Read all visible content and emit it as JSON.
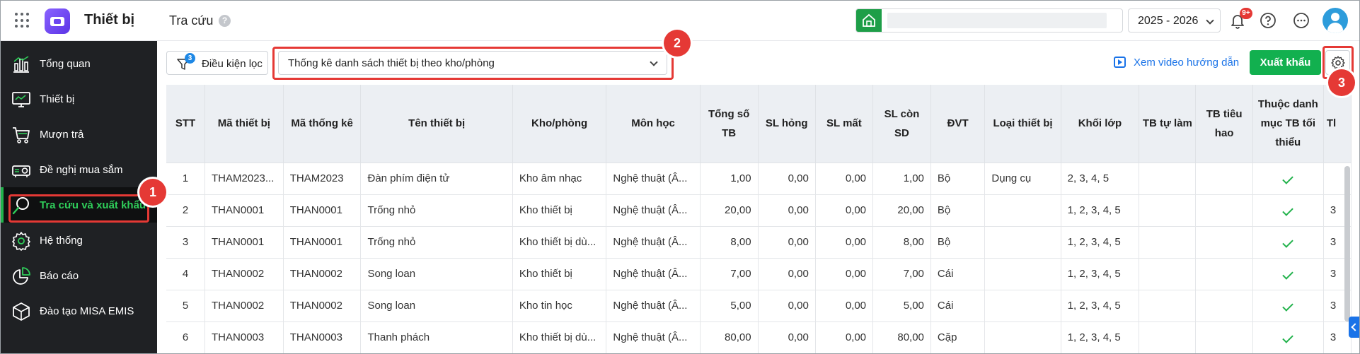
{
  "header": {
    "app_title": "Thiết bị",
    "page_title": "Tra cứu",
    "help_mark": "?",
    "school_year": "2025 - 2026",
    "notification_badge": "9+"
  },
  "sidebar": {
    "items": [
      {
        "label": "Tổng quan",
        "icon": "chart-bars-icon"
      },
      {
        "label": "Thiết bị",
        "icon": "monitor-icon"
      },
      {
        "label": "Mượn trả",
        "icon": "cart-icon"
      },
      {
        "label": "Đề nghị mua sắm",
        "icon": "projector-icon"
      },
      {
        "label": "Tra cứu và xuất khẩu",
        "icon": "search-icon",
        "active": true
      },
      {
        "label": "Hệ thống",
        "icon": "gear-icon"
      },
      {
        "label": "Báo cáo",
        "icon": "pie-chart-icon"
      },
      {
        "label": "Đào tạo MISA EMIS",
        "icon": "box-icon"
      }
    ]
  },
  "toolbar": {
    "filter_label": "Điều kiện lọc",
    "filter_count": "3",
    "report_type": "Thống kê danh sách thiết bị theo kho/phòng",
    "video_link": "Xem video hướng dẫn",
    "export_label": "Xuất khẩu"
  },
  "annotations": [
    "1",
    "2",
    "3"
  ],
  "table": {
    "headers": [
      "STT",
      "Mã thiết bị",
      "Mã thống kê",
      "Tên thiết bị",
      "Kho/phòng",
      "Môn học",
      "Tổng số TB",
      "SL hỏng",
      "SL mất",
      "SL còn SD",
      "ĐVT",
      "Loại thiết bị",
      "Khối lớp",
      "TB tự làm",
      "TB tiêu hao",
      "Thuộc danh mục TB tối thiểu",
      "Tl"
    ],
    "rows": [
      [
        "1",
        "THAM2023...",
        "THAM2023",
        "Đàn phím điện tử",
        "Kho âm nhạc",
        "Nghệ thuật (Â...",
        "1,00",
        "0,00",
        "0,00",
        "1,00",
        "Bộ",
        "Dụng cụ",
        "2, 3, 4, 5",
        "",
        "",
        "check",
        ""
      ],
      [
        "2",
        "THAN0001",
        "THAN0001",
        "Trống nhỏ",
        "Kho thiết bị",
        "Nghệ thuật (Â...",
        "20,00",
        "0,00",
        "0,00",
        "20,00",
        "Bộ",
        "",
        "1, 2, 3, 4, 5",
        "",
        "",
        "check",
        "3"
      ],
      [
        "3",
        "THAN0001",
        "THAN0001",
        "Trống nhỏ",
        "Kho thiết bị dù...",
        "Nghệ thuật (Â...",
        "8,00",
        "0,00",
        "0,00",
        "8,00",
        "Bộ",
        "",
        "1, 2, 3, 4, 5",
        "",
        "",
        "check",
        "3"
      ],
      [
        "4",
        "THAN0002",
        "THAN0002",
        "Song loan",
        "Kho thiết bị",
        "Nghệ thuật (Â...",
        "7,00",
        "0,00",
        "0,00",
        "7,00",
        "Cái",
        "",
        "1, 2, 3, 4, 5",
        "",
        "",
        "check",
        "3"
      ],
      [
        "5",
        "THAN0002",
        "THAN0002",
        "Song loan",
        "Kho tin học",
        "Nghệ thuật (Â...",
        "5,00",
        "0,00",
        "0,00",
        "5,00",
        "Cái",
        "",
        "1, 2, 3, 4, 5",
        "",
        "",
        "check",
        "3"
      ],
      [
        "6",
        "THAN0003",
        "THAN0003",
        "Thanh phách",
        "Kho thiết bị dù...",
        "Nghệ thuật (Â...",
        "80,00",
        "0,00",
        "0,00",
        "80,00",
        "Cặp",
        "",
        "1, 2, 3, 4, 5",
        "",
        "",
        "check",
        "3"
      ]
    ]
  }
}
